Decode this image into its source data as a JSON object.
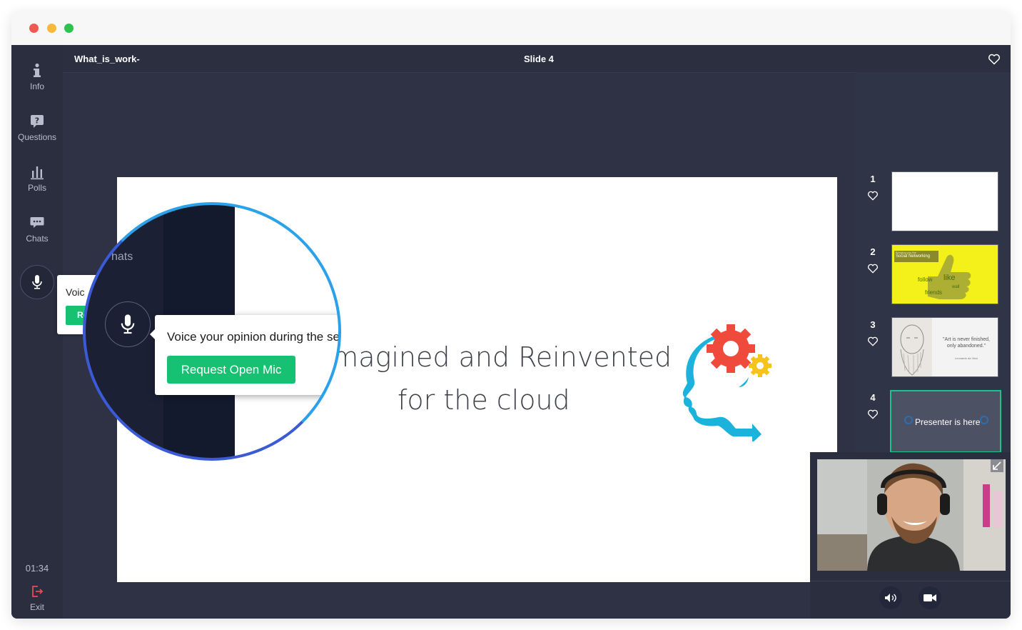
{
  "window": {
    "traffic_lights": {
      "red": "#f25a4f",
      "yellow": "#f5b93b",
      "green": "#2ec24f"
    }
  },
  "sidebar": {
    "items": [
      {
        "label": "Info",
        "icon": "info-icon"
      },
      {
        "label": "Questions",
        "icon": "question-icon"
      },
      {
        "label": "Polls",
        "icon": "poll-icon"
      },
      {
        "label": "Chats",
        "icon": "chat-icon"
      }
    ],
    "mic_icon": "microphone-icon",
    "timer": "01:34",
    "exit_label": "Exit",
    "exit_icon": "exit-icon"
  },
  "header": {
    "presentation_name": "What_is_work-",
    "slide_label": "Slide 4",
    "favorite_icon": "heart-icon"
  },
  "slide": {
    "line1": "Imagined and Reinvented",
    "line2": "for the cloud",
    "illustration": "head-gears-illustration"
  },
  "tooltip_small": {
    "text": "Voic",
    "button_text": "Re"
  },
  "magnifier": {
    "chats_label": "hats",
    "tooltip_text": "Voice your opinion during the se",
    "button_label": "Request Open Mic",
    "accent": "#16c172"
  },
  "thumbnails": [
    {
      "number": "1",
      "caption": ""
    },
    {
      "number": "2",
      "caption_top": "Bringing you the",
      "caption_title": "Social Networking",
      "words": [
        "follow",
        "like",
        "wall",
        "friends"
      ]
    },
    {
      "number": "3",
      "quote": "\"Art is never finished, only abandoned.\"",
      "author": "Leonardo da Vinci"
    },
    {
      "number": "4",
      "caption": "Presenter is here",
      "active": true
    }
  ],
  "video": {
    "expand_icon": "expand-arrow-icon",
    "controls": [
      {
        "name": "speaker",
        "icon": "speaker-icon"
      },
      {
        "name": "camera",
        "icon": "video-camera-icon"
      }
    ]
  },
  "colors": {
    "sidebar_bg": "#2a2e3f",
    "stage_bg": "#2e3244",
    "accent_green": "#16c172",
    "active_border": "#1ec28a",
    "exit_red": "#e54b56",
    "ring_blue": "#2aa1e8"
  }
}
